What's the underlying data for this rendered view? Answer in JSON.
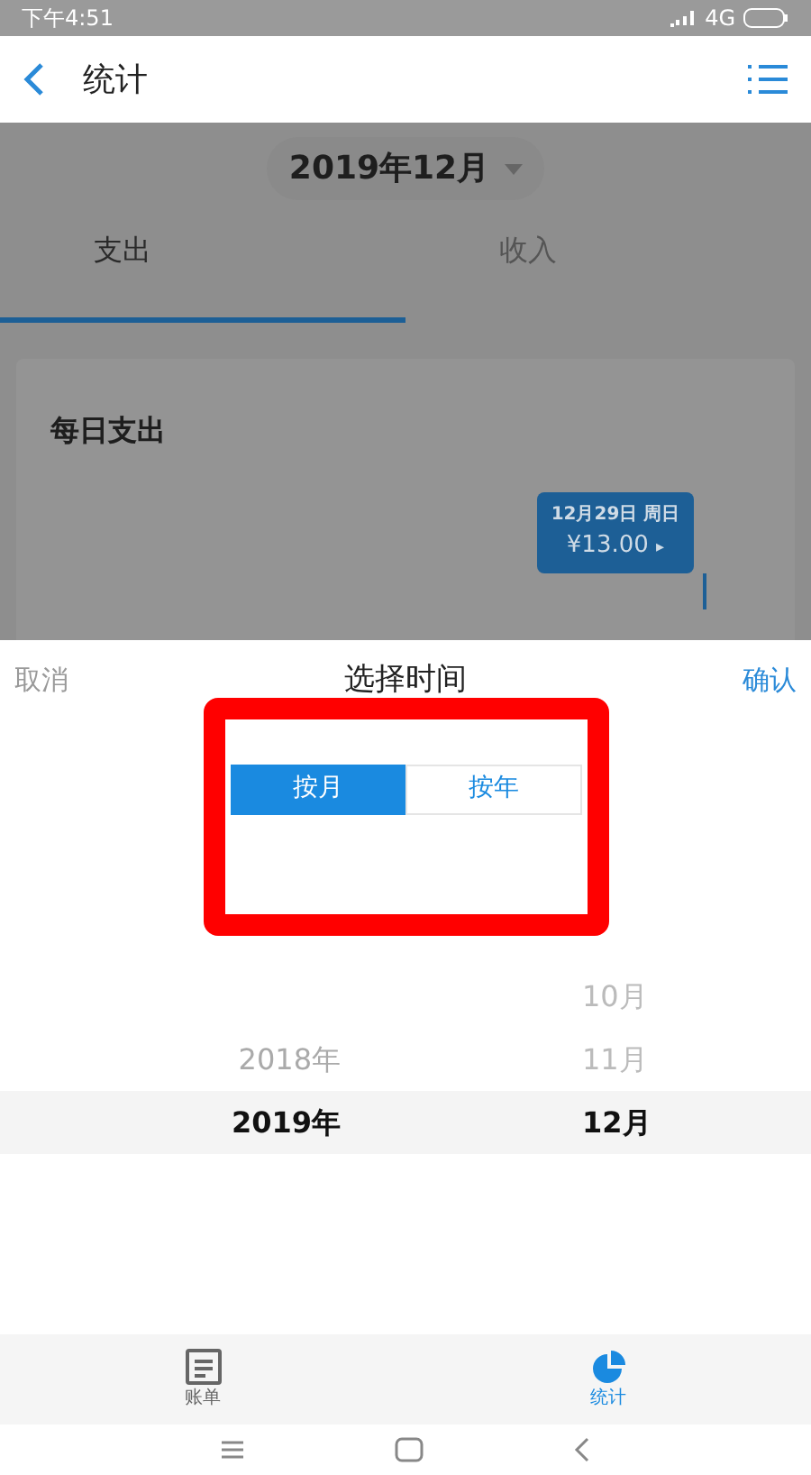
{
  "status_bar": {
    "time": "下午4:51",
    "network": "4G"
  },
  "header": {
    "title": "统计"
  },
  "month_selector": {
    "label": "2019年12月"
  },
  "summary_tabs": [
    {
      "label": "支出",
      "selected": true
    },
    {
      "label": "收入",
      "selected": false
    }
  ],
  "daily_card": {
    "title": "每日支出",
    "tooltip": {
      "date": "12月29日 周日",
      "amount": "¥13.00",
      "arrow": "▸"
    }
  },
  "sheet": {
    "cancel": "取消",
    "title": "选择时间",
    "confirm": "确认",
    "modes": [
      {
        "label": "按月",
        "selected": true
      },
      {
        "label": "按年",
        "selected": false
      }
    ],
    "years": [
      {
        "label": "2018年",
        "selected": false
      },
      {
        "label": "2019年",
        "selected": true
      }
    ],
    "months": [
      {
        "label": "10月",
        "selected": false
      },
      {
        "label": "11月",
        "selected": false
      },
      {
        "label": "12月",
        "selected": true
      }
    ]
  },
  "bottom_tabs": [
    {
      "label": "账单",
      "kind": "bill",
      "selected": false
    },
    {
      "label": "统计",
      "kind": "stats",
      "selected": true
    }
  ]
}
